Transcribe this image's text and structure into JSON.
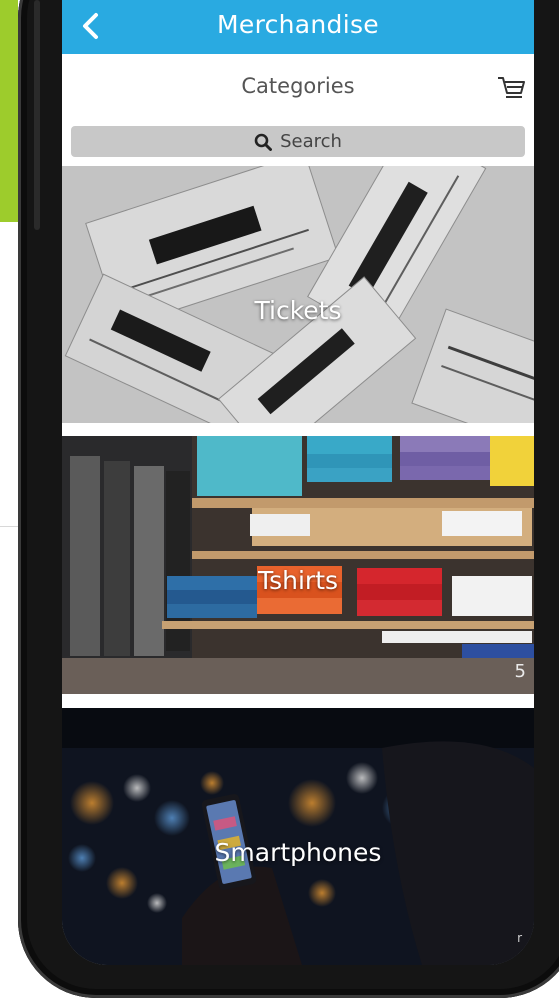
{
  "header": {
    "title": "Merchandise",
    "back_icon": "chevron-left-icon"
  },
  "subheader": {
    "title": "Categories",
    "cart_icon": "cart-icon"
  },
  "search": {
    "label": "Search",
    "icon": "search-icon"
  },
  "categories": [
    {
      "label": "Tickets"
    },
    {
      "label": "Tshirts",
      "count": "5"
    },
    {
      "label": "Smartphones",
      "mark": "r"
    }
  ],
  "colors": {
    "navbar": "#29aae1",
    "accent": "#9dcc2c",
    "search_bg": "#c8c8c8",
    "text_light": "#ffffff"
  }
}
